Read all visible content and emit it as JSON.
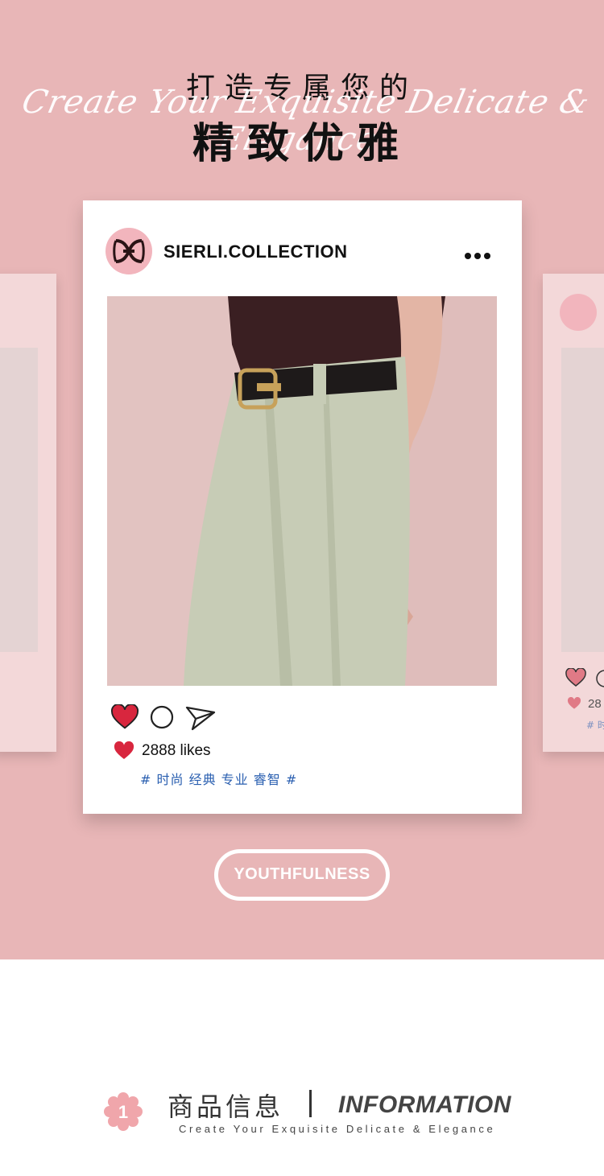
{
  "colors": {
    "hero_bg": "#e8b6b7",
    "accent_pink": "#f2b5bd",
    "heart_red": "#d8263e",
    "tag_blue": "#2a5fb0"
  },
  "hero": {
    "headline_line1": "打造专属您的",
    "headline_line2": "精致优雅",
    "script_text": "Create Your Exquisite Delicate & Elegance"
  },
  "post": {
    "username": "SIERLI.COLLECTION",
    "icons": [
      "logo-icon",
      "more-icon",
      "heart-icon",
      "comment-icon",
      "share-icon"
    ],
    "likes": "2888 likes",
    "tags": "# 时尚 经典 专业 睿智 #"
  },
  "side_cards": {
    "right_likes_fragment": "28",
    "right_tag_fragment": "# 时"
  },
  "pill": {
    "label": "YOUTHFULNESS"
  },
  "info_section": {
    "badge_number": "1",
    "title_cn": "商品信息",
    "title_en": "INFORMATION",
    "subtitle": "Create Your Exquisite Delicate & Elegance"
  }
}
